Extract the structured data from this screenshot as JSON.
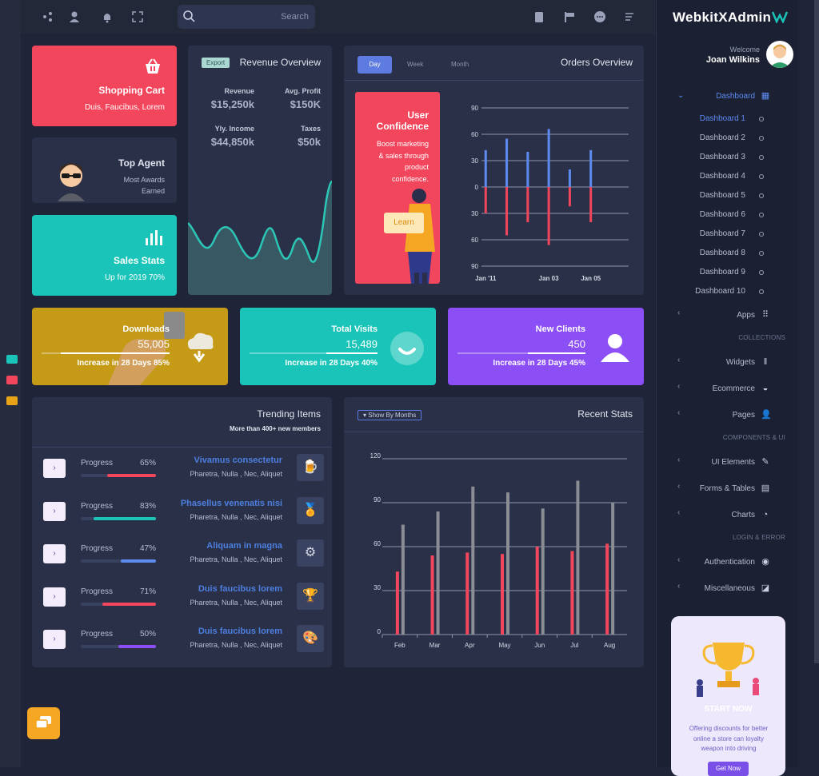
{
  "topbar": {
    "search_placeholder": "Search",
    "icons_left": [
      "share-icon",
      "user-icon",
      "bell-icon",
      "fullscreen-icon"
    ],
    "icons_right": [
      "clipboard-icon",
      "flag-icon",
      "chat-icon",
      "menu-icon"
    ]
  },
  "sidebar": {
    "brand": "WebkitXAdmin",
    "welcome": "Welcome",
    "user_name": "Joan Wilkins",
    "dashboard_label": "Dashboard",
    "dashboards": [
      "Dashboard 1",
      "Dashboard 2",
      "Dashboard 3",
      "Dashboard 4",
      "Dashboard 5",
      "Dashboard 6",
      "Dashboard 7",
      "Dashboard 8",
      "Dashboard 9",
      "Dashboard 10"
    ],
    "apps": "Apps",
    "section_collections": "COLLECTIONS",
    "widgets": "Widgets",
    "ecommerce": "Ecommerce",
    "pages": "Pages",
    "section_components": "COMPONENTS & UI",
    "ui_elements": "UI Elements",
    "forms_tables": "Forms & Tables",
    "charts": "Charts",
    "section_login": "LOGIN & ERROR",
    "authentication": "Authentication",
    "miscellaneous": "Miscellaneous",
    "promo": {
      "title": "START NOW",
      "text": "Offering discounts for better online a store can loyalty weapon into driving",
      "button": "Get Now"
    }
  },
  "shopping_cart": {
    "title": "Shopping Cart",
    "subtitle": "Duis, Faucibus, Lorem"
  },
  "top_agent": {
    "title": "Top Agent",
    "line1": "Most Awards",
    "line2": "Earned"
  },
  "sales_stats": {
    "title": "Sales Stats",
    "subtitle": "Up for 2019 70%"
  },
  "revenue": {
    "badge": "Export",
    "title": "Revenue Overview",
    "metrics": [
      {
        "label": "Revenue",
        "value": "$15,250k"
      },
      {
        "label": "Avg. Profit",
        "value": "$150K"
      },
      {
        "label": "Yly. Income",
        "value": "$44,850k"
      },
      {
        "label": "Taxes",
        "value": "$50k"
      }
    ]
  },
  "orders": {
    "tabs": [
      "Day",
      "Week",
      "Month"
    ],
    "title": "Orders Overview",
    "promo_title": "User Confidence",
    "promo_text": "Boost marketing & sales through product confidence.",
    "promo_button": "Learn"
  },
  "downloads": {
    "title": "Downloads",
    "value": "55,005",
    "footer": "Increase in 28 Days 85%",
    "progress": 0.85
  },
  "visits": {
    "title": "Total Visits",
    "value": "15,489",
    "footer": "Increase in 28 Days 40%",
    "progress": 0.4
  },
  "clients": {
    "title": "New Clients",
    "value": "450",
    "footer": "Increase in 28 Days 45%",
    "progress": 0.45
  },
  "trending": {
    "title": "Trending Items",
    "subtitle": "More than 400+ new members",
    "items": [
      {
        "label": "Progress",
        "pct": "65%",
        "progress": 0.65,
        "color": "#f2465c",
        "title": "Vivamus consectetur",
        "sub": "Pharetra, Nulla , Nec, Aliquet",
        "icon": "beer-icon",
        "glyph": "🍺"
      },
      {
        "label": "Progress",
        "pct": "83%",
        "progress": 0.83,
        "color": "#1ac4b8",
        "title": "Phasellus venenatis nisi",
        "sub": "Pharetra, Nulla , Nec, Aliquet",
        "icon": "badge-icon",
        "glyph": "🏅"
      },
      {
        "label": "Progress",
        "pct": "47%",
        "progress": 0.47,
        "color": "#5d8bf0",
        "title": "Aliquam in magna",
        "sub": "Pharetra, Nulla , Nec, Aliquet",
        "icon": "gear-icon",
        "glyph": "⚙"
      },
      {
        "label": "Progress",
        "pct": "71%",
        "progress": 0.71,
        "color": "#f2465c",
        "title": "Duis faucibus lorem",
        "sub": "Pharetra, Nulla , Nec, Aliquet",
        "icon": "trophy-icon",
        "glyph": "🏆"
      },
      {
        "label": "Progress",
        "pct": "50%",
        "progress": 0.5,
        "color": "#8c4ff5",
        "title": "Duis faucibus lorem",
        "sub": "Pharetra, Nulla , Nec, Aliquet",
        "icon": "palette-icon",
        "glyph": "🎨"
      }
    ]
  },
  "recent_stats": {
    "title": "Recent Stats",
    "filter": "Show By Months"
  },
  "colors": {
    "red": "#f2465c",
    "teal": "#1ac4b8",
    "purple": "#8c4ff5",
    "blue": "#5d8bf0",
    "gold": "#c49a17"
  },
  "chart_data": [
    {
      "type": "bar",
      "x": [
        "Jan '11",
        "",
        "",
        "Jan 03",
        "",
        "Jan 05",
        ""
      ],
      "xticks": [
        "Jan '11",
        "Jan 03",
        "Jan 05"
      ],
      "yticks": [
        90,
        60,
        30,
        0,
        30,
        60,
        90
      ],
      "ylim": [
        -90,
        90
      ],
      "series": [
        {
          "values": [
            42,
            55,
            40,
            66,
            20,
            42,
            null
          ],
          "color": "#5d8bf0"
        },
        {
          "values": [
            -30,
            -55,
            -40,
            -66,
            -22,
            -40,
            null
          ],
          "color": "#f2465c"
        }
      ]
    },
    {
      "type": "bar",
      "categories": [
        "Feb",
        "Mar",
        "Apr",
        "May",
        "Jun",
        "Jul",
        "Aug"
      ],
      "yticks": [
        0,
        30,
        60,
        90,
        120
      ],
      "ylim": [
        0,
        120
      ],
      "series": [
        {
          "values": [
            43,
            54,
            56,
            55,
            60,
            57,
            62
          ],
          "color": "#f2465c"
        },
        {
          "values": [
            75,
            84,
            101,
            97,
            86,
            105,
            90
          ],
          "color": "#8a8d94"
        }
      ]
    }
  ]
}
